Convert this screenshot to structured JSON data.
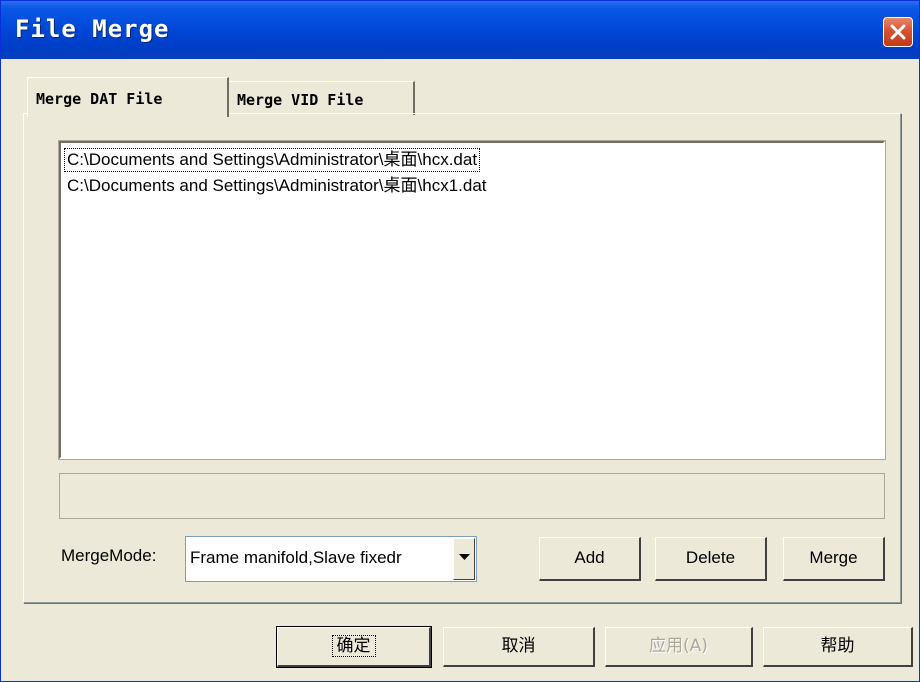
{
  "window": {
    "title": "File Merge",
    "close_label": "close"
  },
  "tabs": [
    {
      "label": "Merge DAT File",
      "active": true
    },
    {
      "label": "Merge VID File",
      "active": false
    }
  ],
  "file_list": {
    "items": [
      "C:\\Documents and Settings\\Administrator\\桌面\\hcx.dat",
      "C:\\Documents and Settings\\Administrator\\桌面\\hcx1.dat"
    ],
    "focused_index": 0
  },
  "progress": {
    "value_percent": 0
  },
  "merge_mode": {
    "label": "MergeMode:",
    "selected": "Frame manifold,Slave fixedr"
  },
  "actions": {
    "add_label": "Add",
    "delete_label": "Delete",
    "merge_label": "Merge"
  },
  "dialog_buttons": {
    "ok_label": "确定",
    "cancel_label": "取消",
    "apply_label": "应用(A)",
    "help_label": "帮助"
  },
  "colors": {
    "title_bar": "#0047d6",
    "face": "#ece9d8",
    "close_button": "#d6542f"
  }
}
